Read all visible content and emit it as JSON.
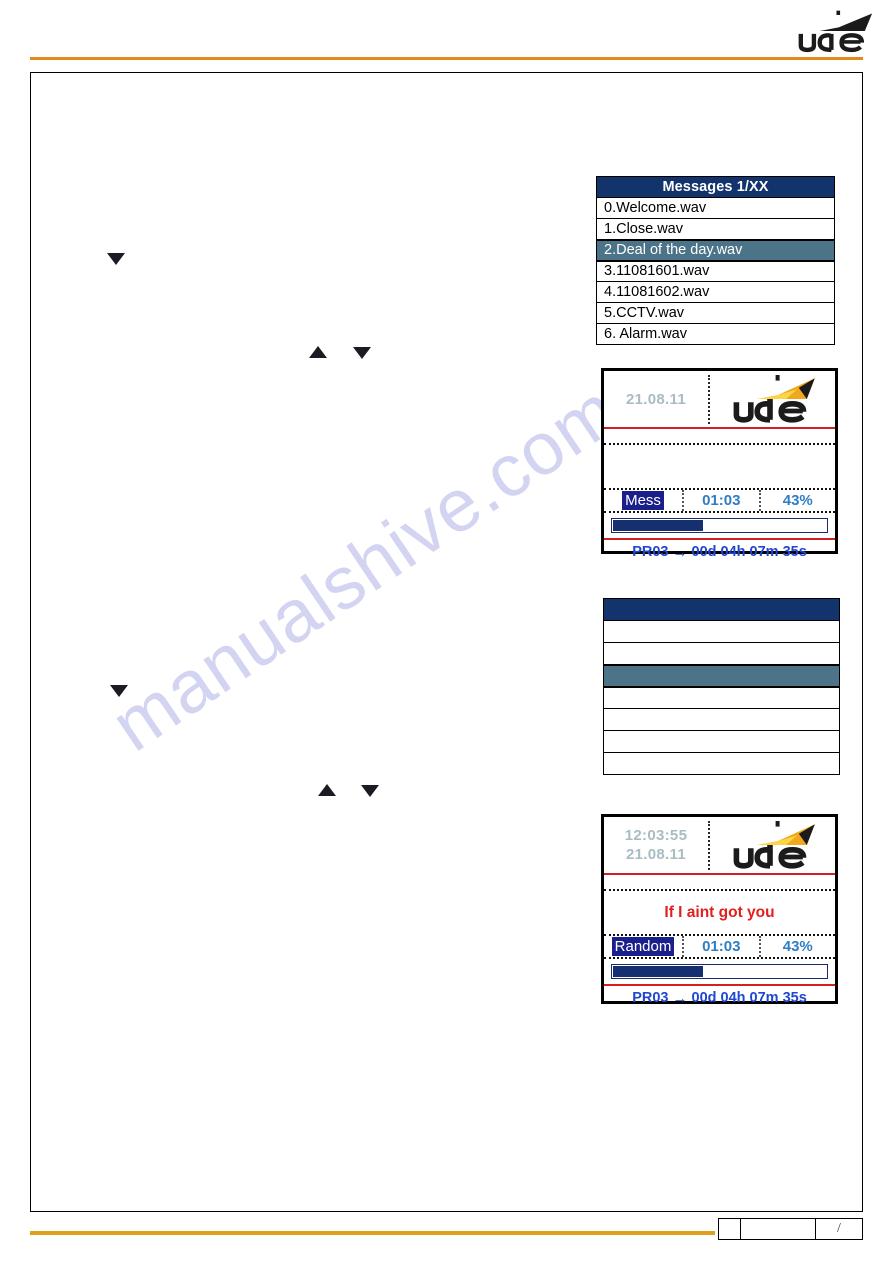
{
  "page": {
    "header_logo": "ude-logo",
    "accent_orange": "#e08b1e",
    "footer_slash": "/"
  },
  "watermark": {
    "text": "manualshive.com"
  },
  "message_list": {
    "title": "Messages 1/XX",
    "rows": [
      {
        "label": "0.Welcome.wav",
        "selected": false
      },
      {
        "label": "1.Close.wav",
        "selected": false
      },
      {
        "label": "2.Deal of the day.wav",
        "selected": true
      },
      {
        "label": "3.11081601.wav",
        "selected": false
      },
      {
        "label": "4.11081602.wav",
        "selected": false
      },
      {
        "label": "5.CCTV.wav",
        "selected": false
      },
      {
        "label": "6. Alarm.wav",
        "selected": false
      }
    ],
    "header_bg": "#12336b",
    "selected_bg": "#4c7489"
  },
  "blank_list": {
    "title": "",
    "rows": [
      {
        "label": "",
        "selected": false
      },
      {
        "label": "",
        "selected": false
      },
      {
        "label": "",
        "selected": true
      },
      {
        "label": "",
        "selected": false
      },
      {
        "label": "",
        "selected": false
      },
      {
        "label": "",
        "selected": false
      },
      {
        "label": "",
        "selected": false
      }
    ]
  },
  "device_1": {
    "clock_time": "",
    "clock_date": "21.08.11",
    "logo": "ude-logo",
    "title": "",
    "mode": "Mess",
    "elapsed": "01:03",
    "percent": "43%",
    "progress_percent": 43,
    "footer_program": "PR03",
    "footer_arrow": "→",
    "footer_countdown": "00d 04h 07m 35s"
  },
  "device_2": {
    "clock_time": "12:03:55",
    "clock_date": "21.08.11",
    "logo": "ude-logo",
    "title": "If I aint got you",
    "mode": "Random",
    "elapsed": "01:03",
    "percent": "43%",
    "progress_percent": 43,
    "footer_program": "PR03",
    "footer_arrow": "→",
    "footer_countdown": "00d 04h 07m 35s"
  }
}
